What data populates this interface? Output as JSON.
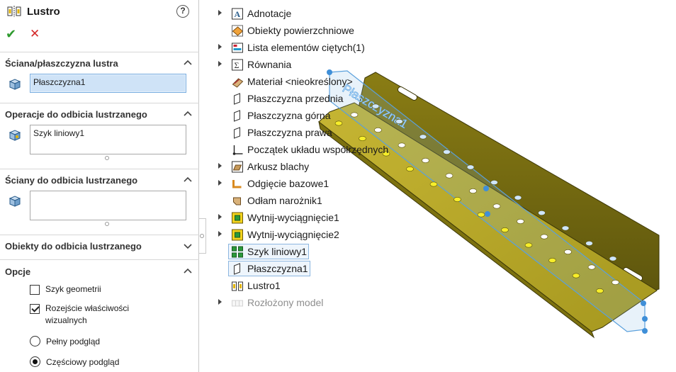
{
  "property_manager": {
    "title": "Lustro",
    "help": "?",
    "ok": "✔",
    "cancel": "✕",
    "sections": {
      "mirror_face": {
        "title": "Ściana/płaszczyzna lustra",
        "value": "Płaszczyzna1"
      },
      "features": {
        "title": "Operacje do odbicia lustrzanego",
        "value": "Szyk liniowy1"
      },
      "faces": {
        "title": "Ściany do odbicia lustrzanego",
        "value": ""
      },
      "bodies": {
        "title": "Obiekty do odbicia lustrzanego"
      },
      "options": {
        "title": "Opcje",
        "geometry_pattern": "Szyk geometrii",
        "propagate_visual": "Rozejście właściwości wizualnych",
        "full_preview": "Pełny podgląd",
        "partial_preview": "Częściowy podgląd"
      }
    }
  },
  "tree": [
    {
      "label": "Adnotacje",
      "icon": "annotations-icon",
      "expand": true
    },
    {
      "label": "Obiekty powierzchniowe",
      "icon": "surface-bodies-icon",
      "expand": false
    },
    {
      "label": "Lista elementów ciętych(1)",
      "icon": "cut-list-icon",
      "expand": true
    },
    {
      "label": "Równania",
      "icon": "equations-icon",
      "expand": true
    },
    {
      "label": "Materiał <nieokreślony>",
      "icon": "material-icon",
      "expand": false
    },
    {
      "label": "Płaszczyzna przednia",
      "icon": "plane-icon",
      "expand": false
    },
    {
      "label": "Płaszczyzna górna",
      "icon": "plane-icon",
      "expand": false
    },
    {
      "label": "Płaszczyzna prawa",
      "icon": "plane-icon",
      "expand": false
    },
    {
      "label": "Początek układu współrzędnych",
      "icon": "origin-icon",
      "expand": false
    },
    {
      "label": "Arkusz blachy",
      "icon": "sheet-metal-icon",
      "expand": true
    },
    {
      "label": "Odgięcie bazowe1",
      "icon": "base-flange-icon",
      "expand": true
    },
    {
      "label": "Odłam narożnik1",
      "icon": "corner-break-icon",
      "expand": false
    },
    {
      "label": "Wytnij-wyciągnięcie1",
      "icon": "cut-extrude-icon",
      "expand": true
    },
    {
      "label": "Wytnij-wyciągnięcie2",
      "icon": "cut-extrude-icon",
      "expand": true
    },
    {
      "label": "Szyk liniowy1",
      "icon": "linear-pattern-icon",
      "expand": false
    },
    {
      "label": "Płaszczyzna1",
      "icon": "plane-icon",
      "expand": false
    },
    {
      "label": "Lustro1",
      "icon": "mirror-icon",
      "expand": false
    },
    {
      "label": "Rozłożony model",
      "icon": "flat-pattern-icon",
      "expand": true
    }
  ],
  "model": {
    "plane_label": "Płaszczyzna1"
  },
  "colors": {
    "part": "#b8a92a",
    "plane": "#7fb8e6",
    "accent": "#2e9a2e"
  }
}
